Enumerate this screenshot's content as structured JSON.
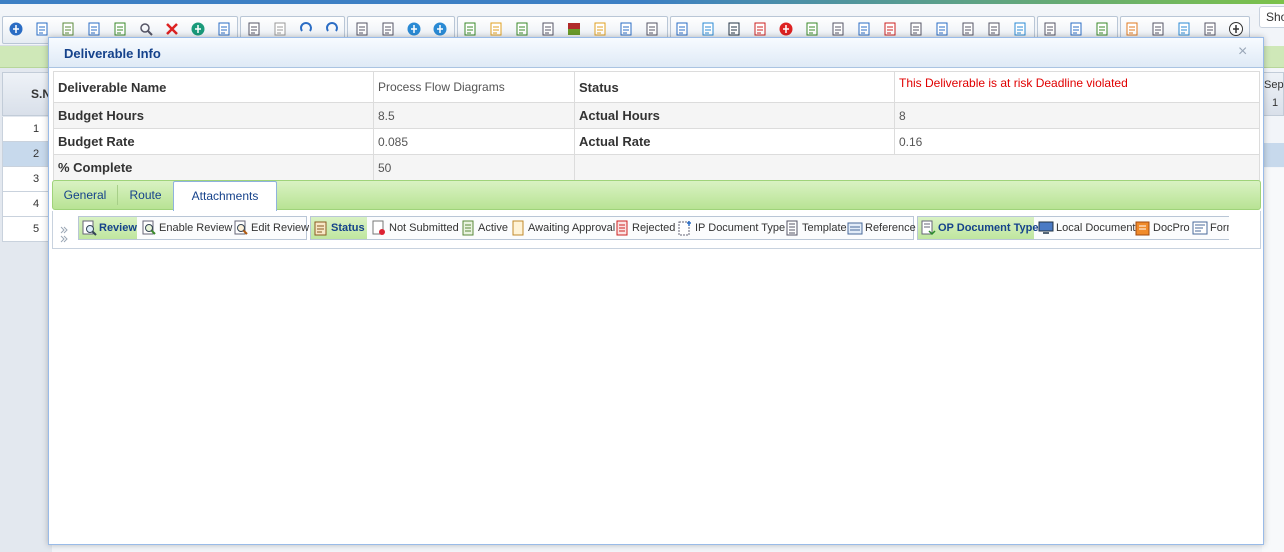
{
  "colors": {
    "accent_blue": "#3c7fc4",
    "accent_green": "#7cc24a",
    "risk_red": "#e00000",
    "title_blue": "#15428b",
    "tab_green": "#b8e394"
  },
  "toolbar": {
    "icons": [
      "info-icon",
      "save-icon",
      "new-doc-icon",
      "edit-doc-icon",
      "excel-icon",
      "search-icon",
      "delete-icon",
      "refresh-icon",
      "fullscreen-icon",
      "copy-icon",
      "paste-icon",
      "undo-icon",
      "redo-icon",
      "indent-icon",
      "outdent-icon",
      "move-up-icon",
      "move-down-icon",
      "columns-icon",
      "gantt-icon",
      "link-icon",
      "split-icon",
      "color-icon",
      "pencil-icon",
      "edit-icon",
      "users-icon",
      "doc-lock-icon",
      "globe-icon",
      "disk-icon",
      "pdf-icon",
      "alert-icon",
      "grid-icon",
      "assign-user-icon",
      "walk-icon",
      "task-icon",
      "group-icon",
      "network-icon",
      "team-icon",
      "copy-doc-icon",
      "chat-icon",
      "print-icon",
      "export-icon",
      "excel-export-icon",
      "sheet-icon",
      "columns-view-icon",
      "clipboard-icon",
      "notes-icon",
      "back-icon"
    ],
    "show_label": "Sho"
  },
  "background_grid": {
    "sn_header": "S.N",
    "rows": [
      "1",
      "2",
      "3",
      "4",
      "5"
    ],
    "selected_row": 2,
    "right_header": "Sep",
    "right_value": "1"
  },
  "dialog": {
    "title": "Deliverable Info",
    "close": "×",
    "fields": {
      "deliverable_name_label": "Deliverable Name",
      "deliverable_name": "Process Flow Diagrams",
      "status_label": "Status",
      "status": "This Deliverable is at risk Deadline violated",
      "budget_hours_label": "Budget Hours",
      "budget_hours": "8.5",
      "actual_hours_label": "Actual Hours",
      "actual_hours": "8",
      "budget_rate_label": "Budget Rate",
      "budget_rate": "0.085",
      "actual_rate_label": "Actual Rate",
      "actual_rate": "0.16",
      "complete_label": "% Complete",
      "complete": "50"
    },
    "tabs": [
      "General",
      "Route",
      "Attachments"
    ],
    "active_tab": "Attachments",
    "attachments_toolbar": {
      "review": "Review",
      "enable_review": "Enable Review",
      "edit_review": "Edit Review",
      "status": "Status",
      "not_submitted": "Not Submitted",
      "active": "Active",
      "awaiting_approval": "Awaiting Approval",
      "rejected": "Rejected",
      "ip_document_type": "IP Document Type",
      "template": "Template",
      "reference": "Reference",
      "op_document_type": "OP Document Type",
      "local_document": "Local Document",
      "docpro": "DocPro",
      "form": "Form"
    }
  }
}
